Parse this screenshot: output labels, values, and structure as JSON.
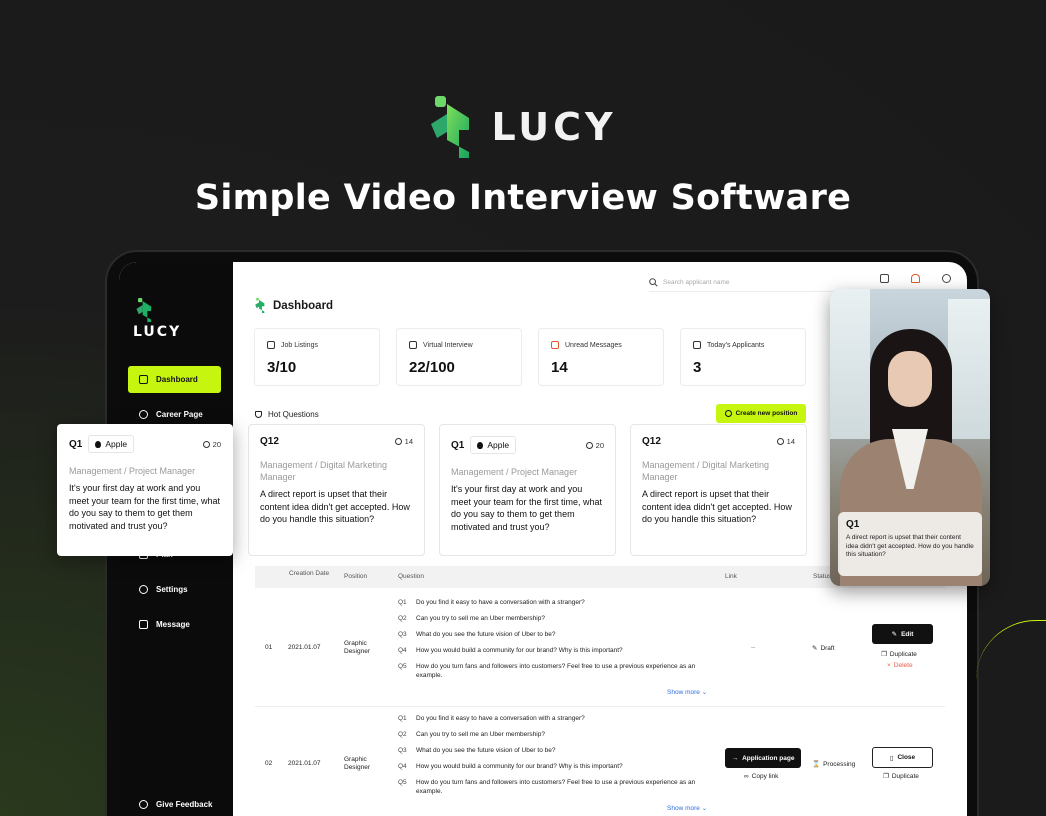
{
  "brand": {
    "name": "LUCY",
    "tagline": "Simple Video Interview Software",
    "accent": "#c6f50f",
    "logo_green": "#2bbf6b"
  },
  "topbar": {
    "search_placeholder": "Search applicant name"
  },
  "sidebar": {
    "items": [
      {
        "label": "Dashboard",
        "icon": "clipboard-icon",
        "active": true
      },
      {
        "label": "Career Page",
        "icon": "target-icon"
      },
      {
        "label": "Plan",
        "icon": "list-icon"
      },
      {
        "label": "Settings",
        "icon": "gear-icon"
      },
      {
        "label": "Message",
        "icon": "mail-icon"
      }
    ],
    "feedback": "Give Feedback"
  },
  "page": {
    "title": "Dashboard"
  },
  "stats": [
    {
      "label": "Job Listings",
      "value": "3/10"
    },
    {
      "label": "Virtual Interview",
      "value": "22/100"
    },
    {
      "label": "Unread Messages",
      "value": "14"
    },
    {
      "label": "Today's Applicants",
      "value": "3"
    }
  ],
  "hot_questions": {
    "title": "Hot Questions",
    "create_label": "Create new position",
    "cards": [
      {
        "q": "Q1",
        "company": "Apple",
        "count": "20",
        "role": "Management / Project Manager",
        "text": "It's your first day at work and you meet your team for the first time, what do you say to them to get them motivated and trust you?"
      },
      {
        "q": "Q12",
        "company": "",
        "count": "14",
        "role": "Management / Digital Marketing Manager",
        "text": "A direct report is upset that their content idea didn't get accepted. How do you handle this situation?"
      },
      {
        "q": "Q1",
        "company": "Apple",
        "count": "20",
        "role": "Management / Project Manager",
        "text": "It's your first day at work and you meet your team for the first time, what do you say to them to get them motivated and trust you?"
      },
      {
        "q": "Q12",
        "company": "",
        "count": "14",
        "role": "Management / Digital Marketing Manager",
        "text": "A direct report is upset that their content idea didn't get accepted. How do you handle this situation?"
      }
    ]
  },
  "table": {
    "headers": {
      "creation_date": "Creation Date",
      "position": "Position",
      "question": "Question",
      "link": "Link",
      "status": "Status"
    },
    "questions": [
      {
        "i": "Q1",
        "t": "Do you find it easy to have a conversation with a stranger?"
      },
      {
        "i": "Q2",
        "t": "Can you try to sell me an Uber membership?"
      },
      {
        "i": "Q3",
        "t": "What do you see the future vision of Uber to be?"
      },
      {
        "i": "Q4",
        "t": "How you would build a community for our brand? Why is this important?"
      },
      {
        "i": "Q5",
        "t": "How do you turn fans and followers into customers? Feel free to use a previous experience as an example."
      }
    ],
    "show_more": "Show more",
    "rows": [
      {
        "no": "01",
        "date": "2021.01.07",
        "position": "Graphic Designer",
        "link": "--",
        "status": "Draft",
        "primary": "Edit",
        "secondary": "Duplicate",
        "tertiary": "Delete"
      },
      {
        "no": "02",
        "date": "2021.01.07",
        "position": "Graphic Designer",
        "link": "Application page",
        "link_sub": "Copy link",
        "status": "Processing",
        "primary": "Close",
        "secondary": "Duplicate"
      }
    ]
  },
  "video": {
    "q": "Q1",
    "text": "A direct report is upset that their content idea didn't get accepted. How do you handle this situation?"
  }
}
